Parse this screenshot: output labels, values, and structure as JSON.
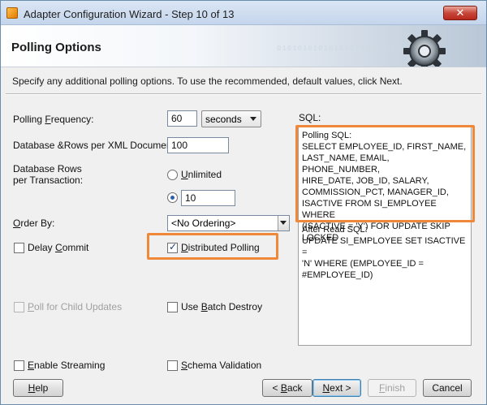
{
  "window": {
    "title": "Adapter Configuration Wizard - Step 10 of 13",
    "close_glyph": "✕"
  },
  "header": {
    "title": "Polling Options",
    "binary_decor": "010101010101010101010101"
  },
  "instructions": "Specify any additional polling options.  To use the recommended, default values, click Next.",
  "form": {
    "polling_frequency": {
      "label_before": "Polling ",
      "label_mnemonic": "F",
      "label_after": "requency:",
      "value": "60",
      "unit": "seconds"
    },
    "rows_per_xml": {
      "label": "Database &Rows per XML Document:",
      "value": "100"
    },
    "rows_per_transaction": {
      "label_line1": "Database Rows",
      "label_line2": "per Transaction:",
      "unlimited_before": "",
      "unlimited_mnemonic": "U",
      "unlimited_after": "nlimited",
      "value": "10"
    },
    "order_by": {
      "label_before": "",
      "label_mnemonic": "O",
      "label_after": "rder By:",
      "value": "<No Ordering>"
    },
    "delay_commit": {
      "before": "Delay ",
      "mnemonic": "C",
      "after": "ommit",
      "checked": false
    },
    "distributed_polling": {
      "before": "",
      "mnemonic": "D",
      "after": "istributed Polling",
      "checked": true
    },
    "poll_child_updates": {
      "before": "",
      "mnemonic": "P",
      "after": "oll for Child Updates",
      "checked": false,
      "enabled": false
    },
    "batch_destroy": {
      "before": "Use ",
      "mnemonic": "B",
      "after": "atch Destroy",
      "checked": false
    },
    "enable_streaming": {
      "before": "",
      "mnemonic": "E",
      "after": "nable Streaming",
      "checked": false
    },
    "schema_validation": {
      "before": "",
      "mnemonic": "S",
      "after": "chema Validation",
      "checked": false
    }
  },
  "sql": {
    "label": "SQL:",
    "polling_sql": "Polling SQL:\nSELECT EMPLOYEE_ID, FIRST_NAME,\nLAST_NAME, EMAIL, PHONE_NUMBER,\nHIRE_DATE, JOB_ID, SALARY,\nCOMMISSION_PCT, MANAGER_ID,\nISACTIVE FROM SI_EMPLOYEE WHERE\n(ISACTIVE = 'Y') FOR UPDATE SKIP\nLOCKED",
    "after_read_sql": "After Read SQL:\nUPDATE SI_EMPLOYEE SET ISACTIVE =\n'N' WHERE (EMPLOYEE_ID =\n#EMPLOYEE_ID)"
  },
  "buttons": {
    "help": {
      "before": "",
      "mnemonic": "H",
      "after": "elp"
    },
    "back": {
      "before": "< ",
      "mnemonic": "B",
      "after": "ack"
    },
    "next": {
      "before": "",
      "mnemonic": "N",
      "after": "ext >"
    },
    "finish": {
      "before": "",
      "mnemonic": "F",
      "after": "inish"
    },
    "cancel": {
      "label": "Cancel"
    }
  },
  "colors": {
    "highlight": "#f0883a",
    "title_bar": "#c4d5ec",
    "close_button": "#c7473b"
  },
  "icons": {
    "window_icon": "app-icon",
    "header_icon": "gear-icon",
    "checkmark": "✓"
  }
}
